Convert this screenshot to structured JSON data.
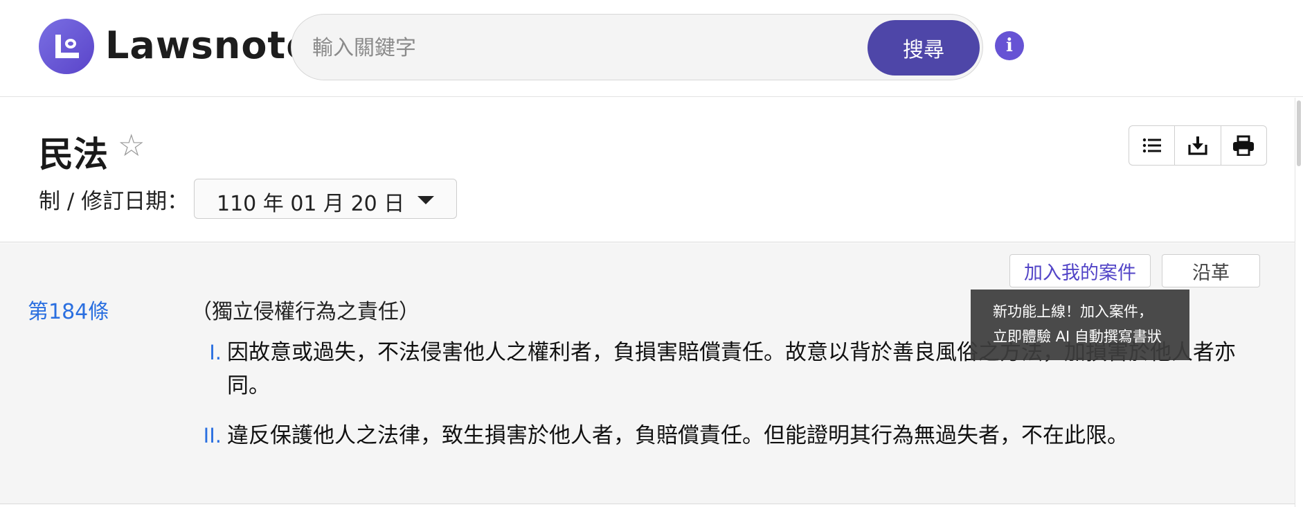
{
  "header": {
    "brand": "Lawsnote",
    "search_placeholder": "輸入關鍵字",
    "search_button": "搜尋",
    "info_icon": "i"
  },
  "law": {
    "title": "民法",
    "date_label": "制 / 修訂日期：",
    "date_value": "110 年 01 月 20 日",
    "toolbar_icons": [
      "list-icon",
      "download-icon",
      "print-icon"
    ]
  },
  "article": {
    "add_case_label": "加入我的案件",
    "history_label": "沿革",
    "number": "第184條",
    "heading": "（獨立侵權行為之責任）",
    "paragraphs": [
      {
        "num": "I.",
        "text": "因故意或過失，不法侵害他人之權利者，負損害賠償責任。故意以背於善良風俗之方法，加損害於他人者亦同。"
      },
      {
        "num": "II.",
        "text": "違反保護他人之法律，致生損害於他人者，負賠償責任。但能證明其行為無過失者，不在此限。"
      }
    ]
  },
  "tooltip": {
    "line1": "新功能上線！加入案件，",
    "line2": "立即體驗 AI 自動撰寫書狀"
  },
  "colors": {
    "accent": "#4e46a8",
    "link": "#2a6fe0",
    "logo": "#6653d4"
  }
}
